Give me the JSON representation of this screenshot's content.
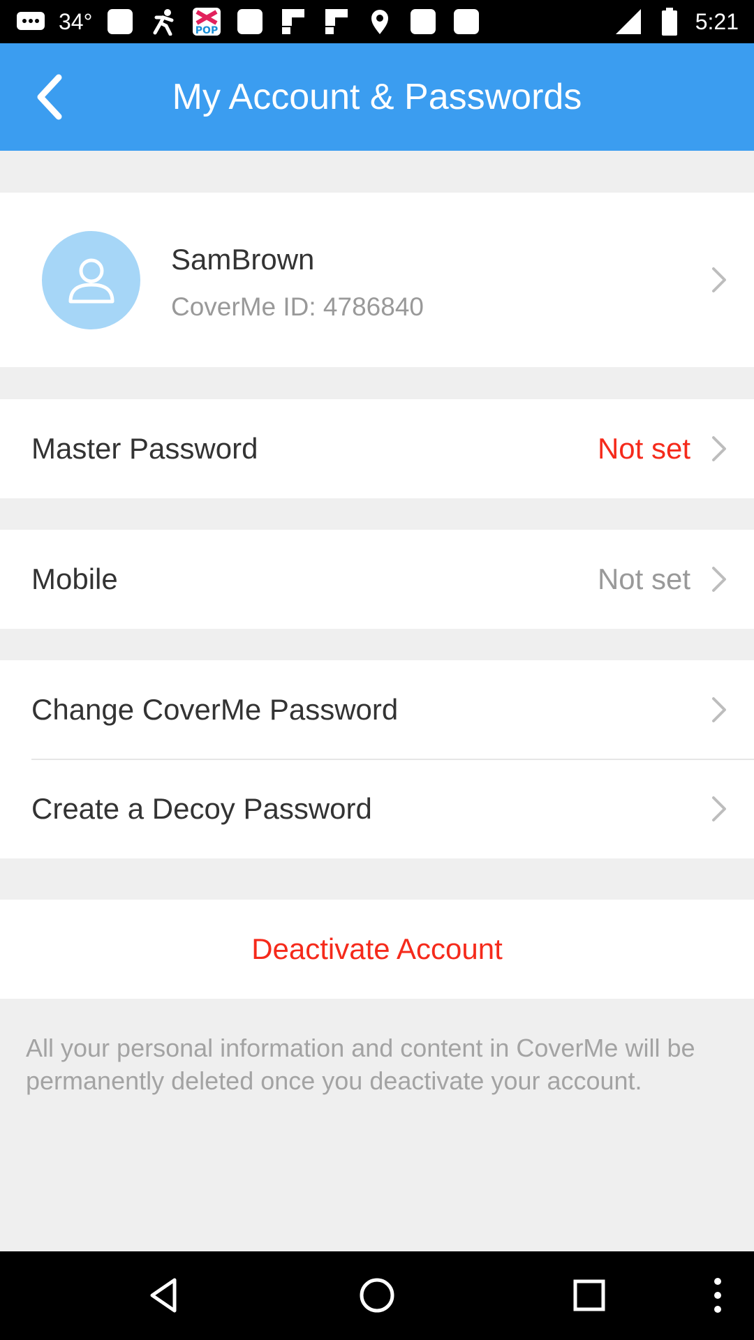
{
  "status_bar": {
    "temperature": "34°",
    "time": "5:21",
    "left_icons": [
      "message-icon",
      "square-icon",
      "runner-icon",
      "pop-app-icon",
      "square-icon",
      "flipboard-icon",
      "flipboard-icon",
      "location-pin-icon",
      "square-icon",
      "square-icon"
    ],
    "right_icons": [
      "signal-icon",
      "battery-icon"
    ]
  },
  "header": {
    "back_icon": "chevron-left-icon",
    "title": "My Account & Passwords",
    "color": "#3b9df0"
  },
  "profile": {
    "avatar_icon": "user-icon",
    "name": "SamBrown",
    "id_label": "CoverMe ID: 4786840"
  },
  "rows": [
    {
      "label": "Master Password",
      "value": "Not set",
      "value_color": "#f52a1b"
    },
    {
      "label": "Mobile",
      "value": "Not set",
      "value_color": "#999999"
    },
    {
      "label": "Change CoverMe Password"
    },
    {
      "label": "Create a Decoy Password"
    }
  ],
  "deactivate": {
    "label": "Deactivate Account",
    "color": "#f52a1b"
  },
  "note": "All your personal information and content in CoverMe will be permanently deleted once you deactivate your account.",
  "nav_bar": {
    "buttons": [
      "back-triangle-icon",
      "home-circle-icon",
      "recents-square-icon",
      "more-vert-icon"
    ]
  }
}
